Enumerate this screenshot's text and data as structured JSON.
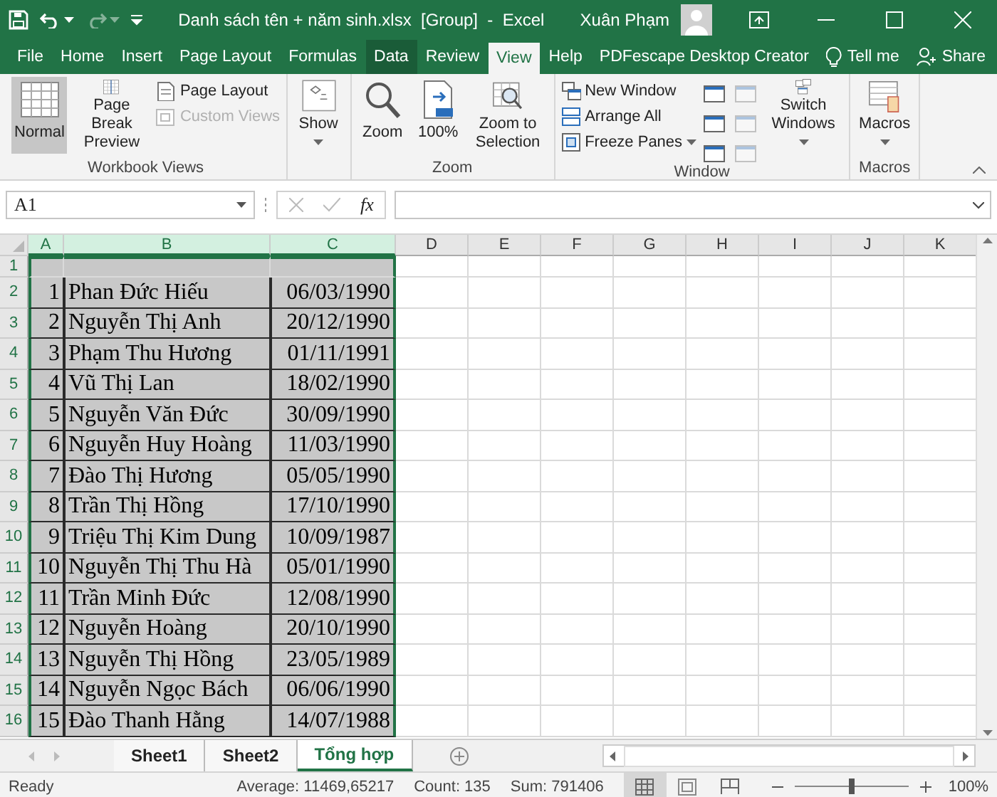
{
  "title_bar": {
    "title": "Danh sách tên + năm sinh.xlsx  [Group]  -  Excel",
    "user": "Xuân Phạm",
    "redo_disabled": true
  },
  "ribbon_tabs": [
    {
      "label": "File",
      "selected": false,
      "hovered": false
    },
    {
      "label": "Home",
      "selected": false,
      "hovered": false
    },
    {
      "label": "Insert",
      "selected": false,
      "hovered": false
    },
    {
      "label": "Page Layout",
      "selected": false,
      "hovered": false
    },
    {
      "label": "Formulas",
      "selected": false,
      "hovered": false
    },
    {
      "label": "Data",
      "selected": false,
      "hovered": true
    },
    {
      "label": "Review",
      "selected": false,
      "hovered": false
    },
    {
      "label": "View",
      "selected": true,
      "hovered": false
    },
    {
      "label": "Help",
      "selected": false,
      "hovered": false
    },
    {
      "label": "PDFescape Desktop Creator",
      "selected": false,
      "hovered": false
    }
  ],
  "tell_me": "Tell me",
  "share": "Share",
  "ribbon_groups": [
    {
      "label": "Workbook Views",
      "items": [
        {
          "kind": "large",
          "label": "Normal",
          "selected": true
        },
        {
          "kind": "large",
          "label": "Page Break Preview",
          "selected": false
        },
        {
          "kind": "smalls",
          "items": [
            {
              "label": "Page Layout",
              "disabled": false
            },
            {
              "label": "Custom Views",
              "disabled": true
            }
          ]
        }
      ]
    },
    {
      "items": [
        {
          "kind": "large",
          "label": "Show",
          "dropdown": true
        }
      ]
    },
    {
      "label": "Zoom",
      "items": [
        {
          "kind": "large",
          "label": "Zoom"
        },
        {
          "kind": "large",
          "label": "100%"
        },
        {
          "kind": "large",
          "label": "Zoom to Selection"
        }
      ]
    },
    {
      "label": "Window",
      "items": [
        {
          "kind": "smalls",
          "items": [
            {
              "label": "New Window",
              "disabled": false
            },
            {
              "label": "Arrange All",
              "disabled": false
            },
            {
              "label": "Freeze Panes",
              "disabled": false,
              "dropdown": true
            }
          ]
        },
        {
          "kind": "icons",
          "items": [
            {
              "disabled": false
            },
            {
              "disabled": false
            },
            {
              "disabled": false
            }
          ]
        },
        {
          "kind": "icons",
          "items": [
            {
              "disabled": true
            },
            {
              "disabled": true
            },
            {
              "disabled": true
            }
          ]
        },
        {
          "kind": "large",
          "label": "Switch Windows",
          "dropdown": true
        }
      ]
    },
    {
      "label": "Macros",
      "items": [
        {
          "kind": "large",
          "label": "Macros",
          "dropdown": true
        }
      ]
    }
  ],
  "formula_bar": {
    "name_box": "A1",
    "function_symbol": "fx"
  },
  "sheet": {
    "columns": [
      {
        "label": "A",
        "selected": true
      },
      {
        "label": "B",
        "selected": true
      },
      {
        "label": "C",
        "selected": true
      },
      {
        "label": "D",
        "selected": false
      },
      {
        "label": "E",
        "selected": false
      },
      {
        "label": "F",
        "selected": false
      },
      {
        "label": "G",
        "selected": false
      },
      {
        "label": "H",
        "selected": false
      },
      {
        "label": "I",
        "selected": false
      },
      {
        "label": "J",
        "selected": false
      },
      {
        "label": "K",
        "selected": false
      }
    ],
    "rows": [
      {
        "header": "1",
        "selected": true
      },
      {
        "header": "2",
        "selected": true,
        "cells": [
          "1",
          "Phan Đức Hiếu",
          "06/03/1990"
        ]
      },
      {
        "header": "3",
        "selected": true,
        "cells": [
          "2",
          "Nguyễn Thị Anh",
          "20/12/1990"
        ]
      },
      {
        "header": "4",
        "selected": true,
        "cells": [
          "3",
          "Phạm Thu Hương",
          "01/11/1991"
        ]
      },
      {
        "header": "5",
        "selected": true,
        "cells": [
          "4",
          "Vũ Thị Lan",
          "18/02/1990"
        ]
      },
      {
        "header": "6",
        "selected": true,
        "cells": [
          "5",
          "Nguyễn Văn Đức",
          "30/09/1990"
        ]
      },
      {
        "header": "7",
        "selected": true,
        "cells": [
          "6",
          "Nguyễn Huy Hoàng",
          "11/03/1990"
        ]
      },
      {
        "header": "8",
        "selected": true,
        "cells": [
          "7",
          "Đào Thị Hương",
          "05/05/1990"
        ]
      },
      {
        "header": "9",
        "selected": true,
        "cells": [
          "8",
          "Trần Thị Hồng",
          "17/10/1990"
        ]
      },
      {
        "header": "10",
        "selected": true,
        "cells": [
          "9",
          "Triệu Thị Kim Dung",
          "10/09/1987"
        ]
      },
      {
        "header": "11",
        "selected": true,
        "cells": [
          "10",
          "Nguyễn Thị Thu Hà",
          "05/01/1990"
        ]
      },
      {
        "header": "12",
        "selected": true,
        "cells": [
          "11",
          "Trần Minh Đức",
          "12/08/1990"
        ]
      },
      {
        "header": "13",
        "selected": true,
        "cells": [
          "12",
          "Nguyễn Hoàng",
          "20/10/1990"
        ]
      },
      {
        "header": "14",
        "selected": true,
        "cells": [
          "13",
          "Nguyễn Thị Hồng",
          "23/05/1989"
        ]
      },
      {
        "header": "15",
        "selected": true,
        "cells": [
          "14",
          "Nguyễn Ngọc Bách",
          "06/06/1990"
        ]
      },
      {
        "header": "16",
        "selected": true,
        "cells": [
          "15",
          "Đào Thanh Hằng",
          "14/07/1988"
        ]
      }
    ]
  },
  "sheet_tabs": [
    {
      "label": "Sheet1",
      "selected": false
    },
    {
      "label": "Sheet2",
      "selected": false
    },
    {
      "label": "Tổng hợp",
      "selected": true
    }
  ],
  "status_bar": {
    "status": "Ready",
    "average": "Average: 11469,65217",
    "count": "Count: 135",
    "sum": "Sum: 791406",
    "views": [
      {
        "selected": true
      },
      {
        "selected": false
      },
      {
        "selected": false
      }
    ],
    "zoom_slider": {
      "level": 0.5
    },
    "zoom": "100%"
  }
}
